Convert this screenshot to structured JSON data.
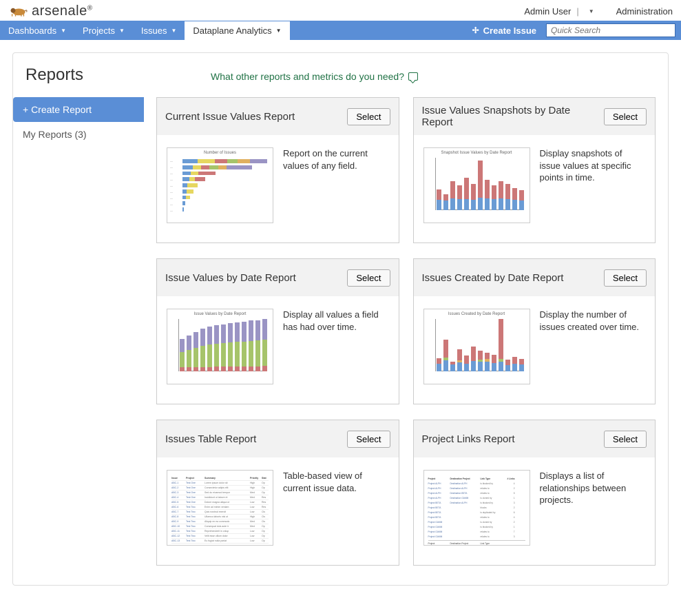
{
  "header": {
    "brand": "arsenale",
    "user": "Admin User",
    "admin_link": "Administration"
  },
  "nav": {
    "items": [
      {
        "label": "Dashboards"
      },
      {
        "label": "Projects"
      },
      {
        "label": "Issues"
      },
      {
        "label": "Dataplane Analytics"
      }
    ],
    "create_issue": "Create Issue",
    "search_placeholder": "Quick Search"
  },
  "page": {
    "title": "Reports",
    "feedback": "What other reports and metrics do you need?"
  },
  "sidebar": {
    "create": "+ Create Report",
    "my_reports": "My Reports (3)"
  },
  "cards": [
    {
      "title": "Current Issue Values Report",
      "select": "Select",
      "desc": "Report on the current values of any field."
    },
    {
      "title": "Issue Values Snapshots by Date Report",
      "select": "Select",
      "desc": "Display snapshots of issue values at specific points in time."
    },
    {
      "title": "Issue Values by Date Report",
      "select": "Select",
      "desc": "Display all values a field has had over time."
    },
    {
      "title": "Issues Created by Date Report",
      "select": "Select",
      "desc": "Display the number of issues created over time."
    },
    {
      "title": "Issues Table Report",
      "select": "Select",
      "desc": "Table-based view of current issue data."
    },
    {
      "title": "Project Links Report",
      "select": "Select",
      "desc": "Displays a list of relationships between projects."
    }
  ],
  "colors": {
    "navbar": "#5a8ed6",
    "green": "#207245",
    "bar_red": "#c77",
    "bar_blue": "#6a9bd4",
    "bar_green": "#a6c46a",
    "bar_purple": "#9a94c4",
    "bar_orange": "#e0b060",
    "bar_yellow": "#e6d760"
  }
}
